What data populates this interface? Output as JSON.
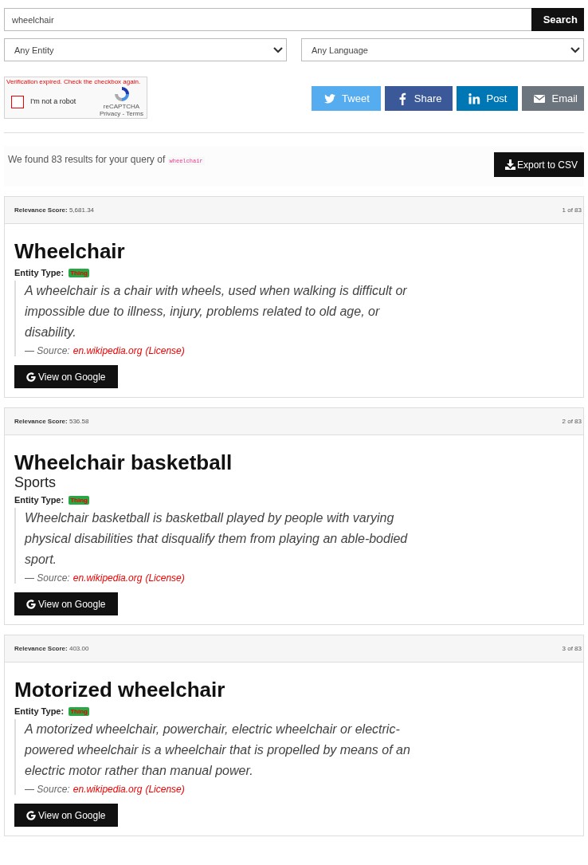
{
  "search": {
    "value": "wheelchair",
    "button": "Search"
  },
  "filters": [
    {
      "value": "Any Entity"
    },
    {
      "value": "Any Language"
    }
  ],
  "captcha": {
    "error": "Verification expired. Check the checkbox again.",
    "label": "I'm not a robot",
    "checked": false,
    "brand": "reCAPTCHA",
    "links": "Privacy - Terms"
  },
  "share_buttons": [
    {
      "kind": "twitter",
      "label": "Tweet"
    },
    {
      "kind": "facebook",
      "label": "Share"
    },
    {
      "kind": "linkedin",
      "label": "Post"
    },
    {
      "kind": "email",
      "label": "Email"
    }
  ],
  "summary": {
    "text": "We found 83 results for your query of",
    "query": "wheelchair"
  },
  "export_button": "Export to CSV",
  "results": [
    {
      "score_label": "Relevance Score:",
      "score": "5,681.34",
      "position": "1 of 83",
      "title": "Wheelchair",
      "entity_type_label": "Entity Type:",
      "entity_type": "Thing",
      "description": "A wheelchair is a chair with wheels, used when walking is difficult or impossible due to illness, injury, problems related to old age, or disability.",
      "source_prefix": "— Source:",
      "source": "en.wikipedia.org",
      "license": "(License)",
      "button": "View on Google"
    },
    {
      "score_label": "Relevance Score:",
      "score": "536.58",
      "position": "2 of 83",
      "title": "Wheelchair basketball",
      "subtitle": "Sports",
      "entity_type_label": "Entity Type:",
      "entity_type": "Thing",
      "description": "Wheelchair basketball is basketball played by people with varying physical disabilities that disqualify them from playing an able-bodied sport.",
      "source_prefix": "— Source:",
      "source": "en.wikipedia.org",
      "license": "(License)",
      "button": "View on Google"
    },
    {
      "score_label": "Relevance Score:",
      "score": "403.00",
      "position": "3 of 83",
      "title": "Motorized wheelchair",
      "entity_type_label": "Entity Type:",
      "entity_type": "Thing",
      "description": "A motorized wheelchair, powerchair, electric wheelchair or electric-powered wheelchair is a wheelchair that is propelled by means of an electric motor rather than manual power.",
      "source_prefix": "— Source:",
      "source": "en.wikipedia.org",
      "license": "(License)",
      "button": "View on Google"
    }
  ]
}
